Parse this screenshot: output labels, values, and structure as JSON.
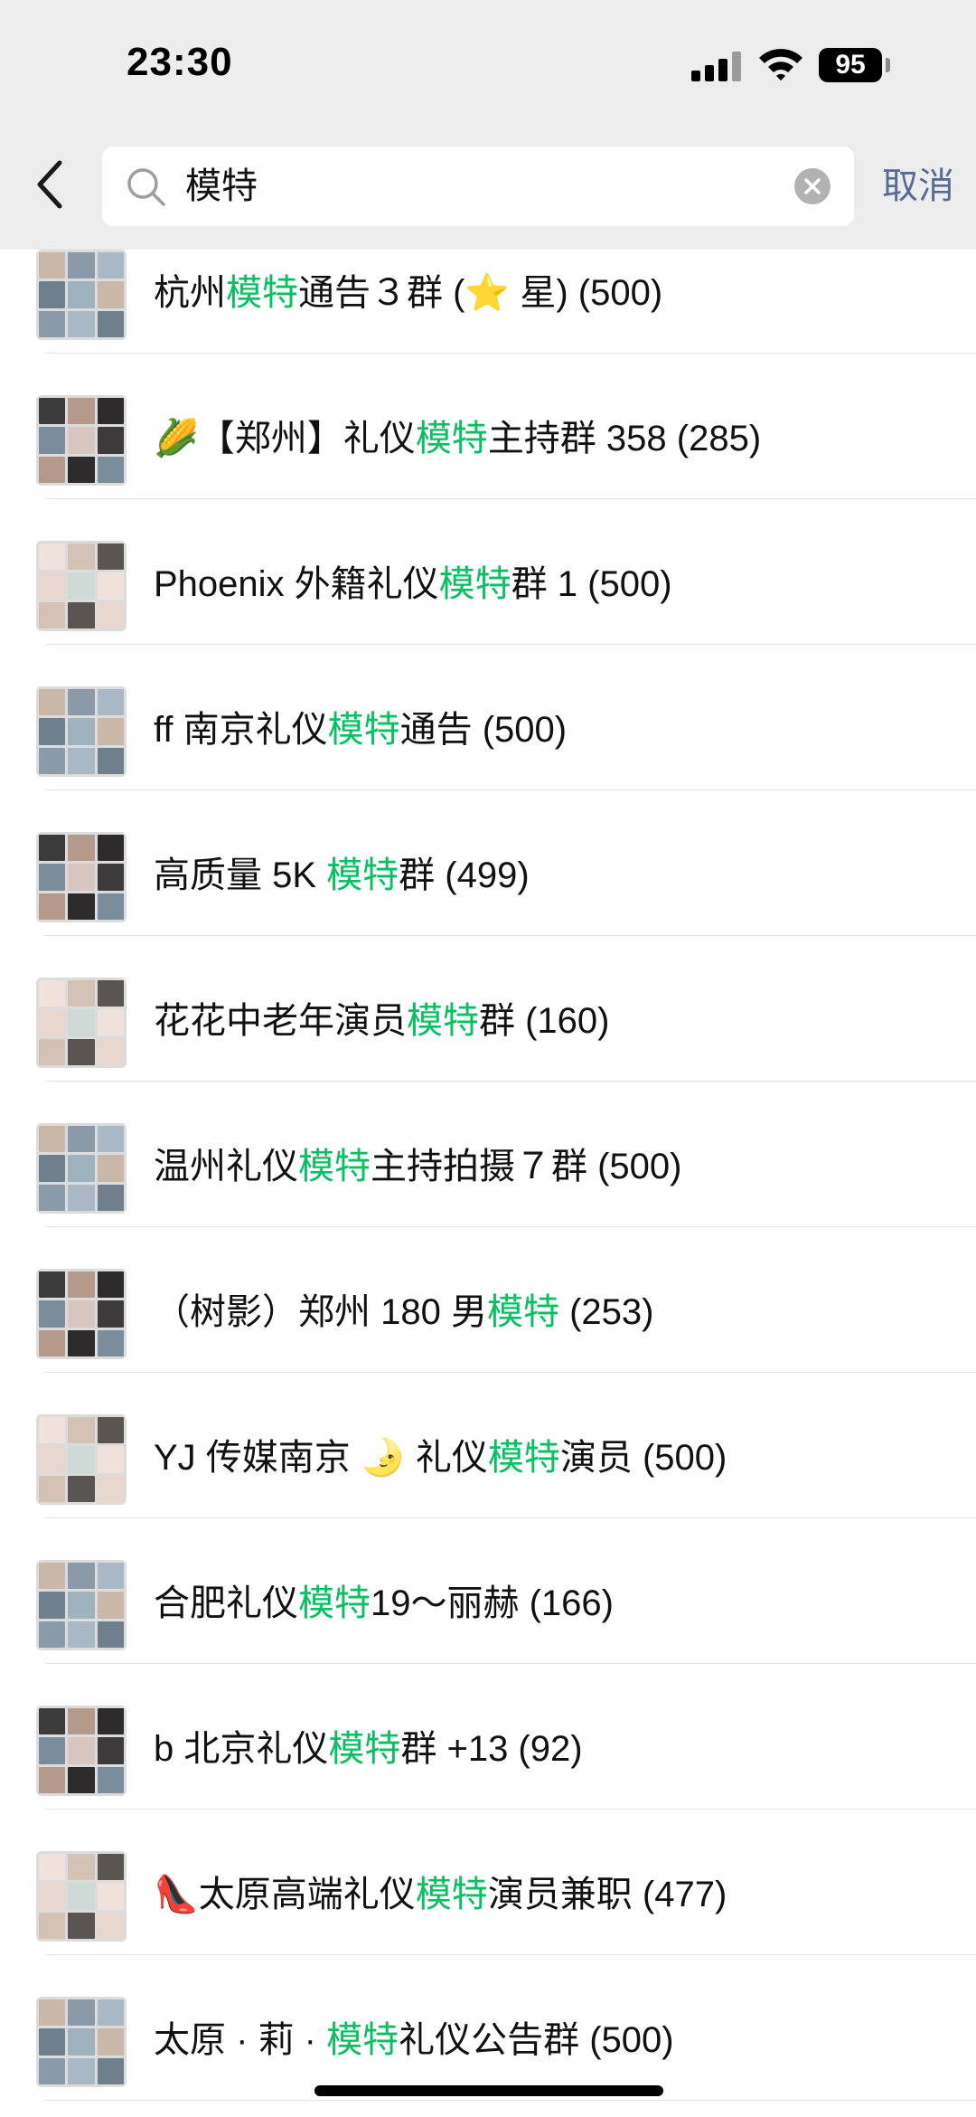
{
  "status_bar": {
    "time": "23:30",
    "battery": "95"
  },
  "search": {
    "query": "模特",
    "cancel_label": "取消"
  },
  "highlight_color": "#07c160",
  "groups": [
    {
      "pre": "杭州",
      "hl": "模特",
      "post": "通告３群 (⭐ 星) (500)"
    },
    {
      "pre": "🌽【郑州】礼仪",
      "hl": "模特",
      "post": "主持群 358 (285)"
    },
    {
      "pre": "Phoenix 外籍礼仪",
      "hl": "模特",
      "post": "群 1 (500)"
    },
    {
      "pre": "ff 南京礼仪",
      "hl": "模特",
      "post": "通告 (500)"
    },
    {
      "pre": "高质量 5K ",
      "hl": "模特",
      "post": "群 (499)"
    },
    {
      "pre": "花花中老年演员",
      "hl": "模特",
      "post": "群 (160)"
    },
    {
      "pre": "温州礼仪",
      "hl": "模特",
      "post": "主持拍摄７群 (500)"
    },
    {
      "pre": "（树影）郑州 180 男",
      "hl": "模特",
      "post": " (253)"
    },
    {
      "pre": "YJ 传媒南京 🌛 礼仪",
      "hl": "模特",
      "post": "演员 (500)"
    },
    {
      "pre": "合肥礼仪",
      "hl": "模特",
      "post": "19～丽赫 (166)"
    },
    {
      "pre": "b 北京礼仪",
      "hl": "模特",
      "post": "群 +13 (92)"
    },
    {
      "pre": "👠太原高端礼仪",
      "hl": "模特",
      "post": "演员兼职 (477)"
    },
    {
      "pre": "太原 · 莉 · ",
      "hl": "模特",
      "post": "礼仪公告群 (500)"
    }
  ]
}
